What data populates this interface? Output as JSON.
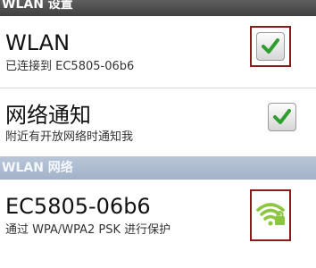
{
  "settings_header": "WLAN 设置",
  "wlan": {
    "title": "WLAN",
    "summary": "已连接到 EC5805-06b6",
    "checked": true
  },
  "notify": {
    "title": "网络通知",
    "summary": "附近有开放网络时通知我",
    "checked": true
  },
  "network_header": "WLAN 网络",
  "network": {
    "ssid": "EC5805-06b6",
    "summary": "通过 WPA/WPA2 PSK 进行保护",
    "icon": "wifi-secured-icon"
  },
  "colors": {
    "check": "#2e9e2e",
    "highlight": "#8b1a1a",
    "wifi": "#8cc63f"
  }
}
